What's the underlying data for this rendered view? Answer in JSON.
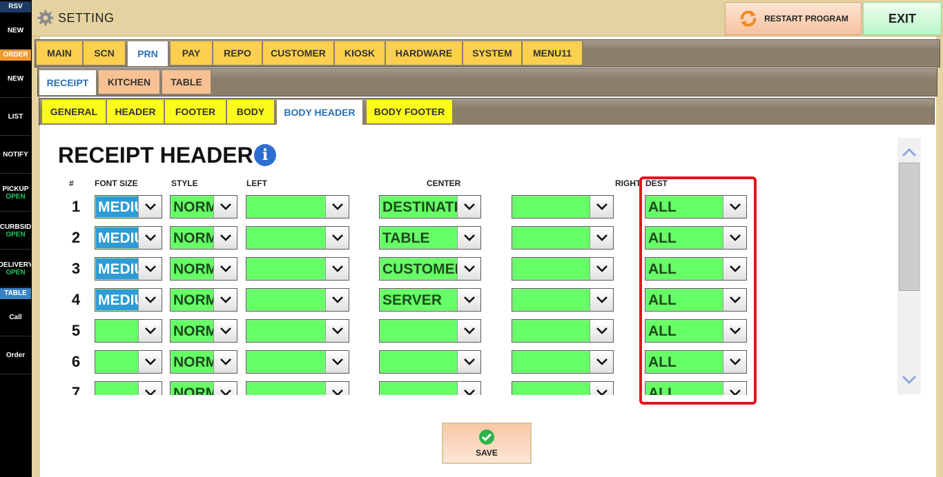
{
  "sidebar": {
    "headers": [
      {
        "label": "RSV",
        "color": "#1f3a64"
      },
      {
        "label": "ORDER",
        "color": "#f29a2e"
      },
      {
        "label": "TABLE",
        "color": "#3b82c4"
      }
    ],
    "items": [
      {
        "label": "NEW",
        "status": ""
      },
      {
        "label": "NEW",
        "status": ""
      },
      {
        "label": "LIST",
        "status": ""
      },
      {
        "label": "NOTIFY",
        "status": ""
      },
      {
        "label": "PICKUP",
        "status": "OPEN"
      },
      {
        "label": "CURBSID",
        "status": "OPEN"
      },
      {
        "label": "DELIVERY",
        "status": "OPEN"
      },
      {
        "label": "Call",
        "status": ""
      },
      {
        "label": "Order",
        "status": ""
      }
    ]
  },
  "topbar": {
    "title": "SETTING",
    "restart_label": "RESTART PROGRAM",
    "exit_label": "EXIT"
  },
  "tabs": {
    "main": [
      "MAIN",
      "SCN",
      "PRN",
      "PAY",
      "REPO",
      "CUSTOMER",
      "KIOSK",
      "HARDWARE",
      "SYSTEM",
      "MENU11"
    ],
    "main_active": "PRN",
    "receipt": [
      "RECEIPT",
      "KITCHEN",
      "TABLE"
    ],
    "receipt_active": "RECEIPT",
    "sub": [
      "GENERAL",
      "HEADER",
      "FOOTER",
      "BODY",
      "BODY HEADER",
      "BODY FOOTER"
    ],
    "sub_active": "BODY HEADER"
  },
  "section": {
    "title": "RECEIPT HEADER",
    "info_icon": "info-icon"
  },
  "columns": {
    "num": "#",
    "font_size": "FONT SIZE",
    "style": "STYLE",
    "left": "LEFT",
    "center": "CENTER",
    "right": "RIGHT",
    "dest": "DEST"
  },
  "rows": [
    {
      "num": "1",
      "font_size": "MEDIUM",
      "style": "NORMAL",
      "left": "",
      "center": "DESTINATION",
      "right": "",
      "dest": "ALL"
    },
    {
      "num": "2",
      "font_size": "MEDIUM",
      "style": "NORMAL",
      "left": "",
      "center": "TABLE",
      "right": "",
      "dest": "ALL"
    },
    {
      "num": "3",
      "font_size": "MEDIUM",
      "style": "NORMAL",
      "left": "",
      "center": "CUSTOMER",
      "right": "",
      "dest": "ALL"
    },
    {
      "num": "4",
      "font_size": "MEDIUM",
      "style": "NORMAL",
      "left": "",
      "center": "SERVER",
      "right": "",
      "dest": "ALL"
    },
    {
      "num": "5",
      "font_size": "",
      "style": "NORMAL",
      "left": "",
      "center": "",
      "right": "",
      "dest": "ALL"
    },
    {
      "num": "6",
      "font_size": "",
      "style": "NORMAL",
      "left": "",
      "center": "",
      "right": "",
      "dest": "ALL"
    },
    {
      "num": "7",
      "font_size": "",
      "style": "NORMAL",
      "left": "",
      "center": "",
      "right": "",
      "dest": "ALL"
    }
  ],
  "save": {
    "label": "SAVE"
  },
  "colors": {
    "select_green": "#66ff66",
    "font_size_blue": "#2e9bd6",
    "highlight_red": "#e8121c",
    "tab_yellow": "#fcd04e",
    "subtab_yellow": "#fbfc1a",
    "receipt_tab_peach": "#f8c193"
  }
}
